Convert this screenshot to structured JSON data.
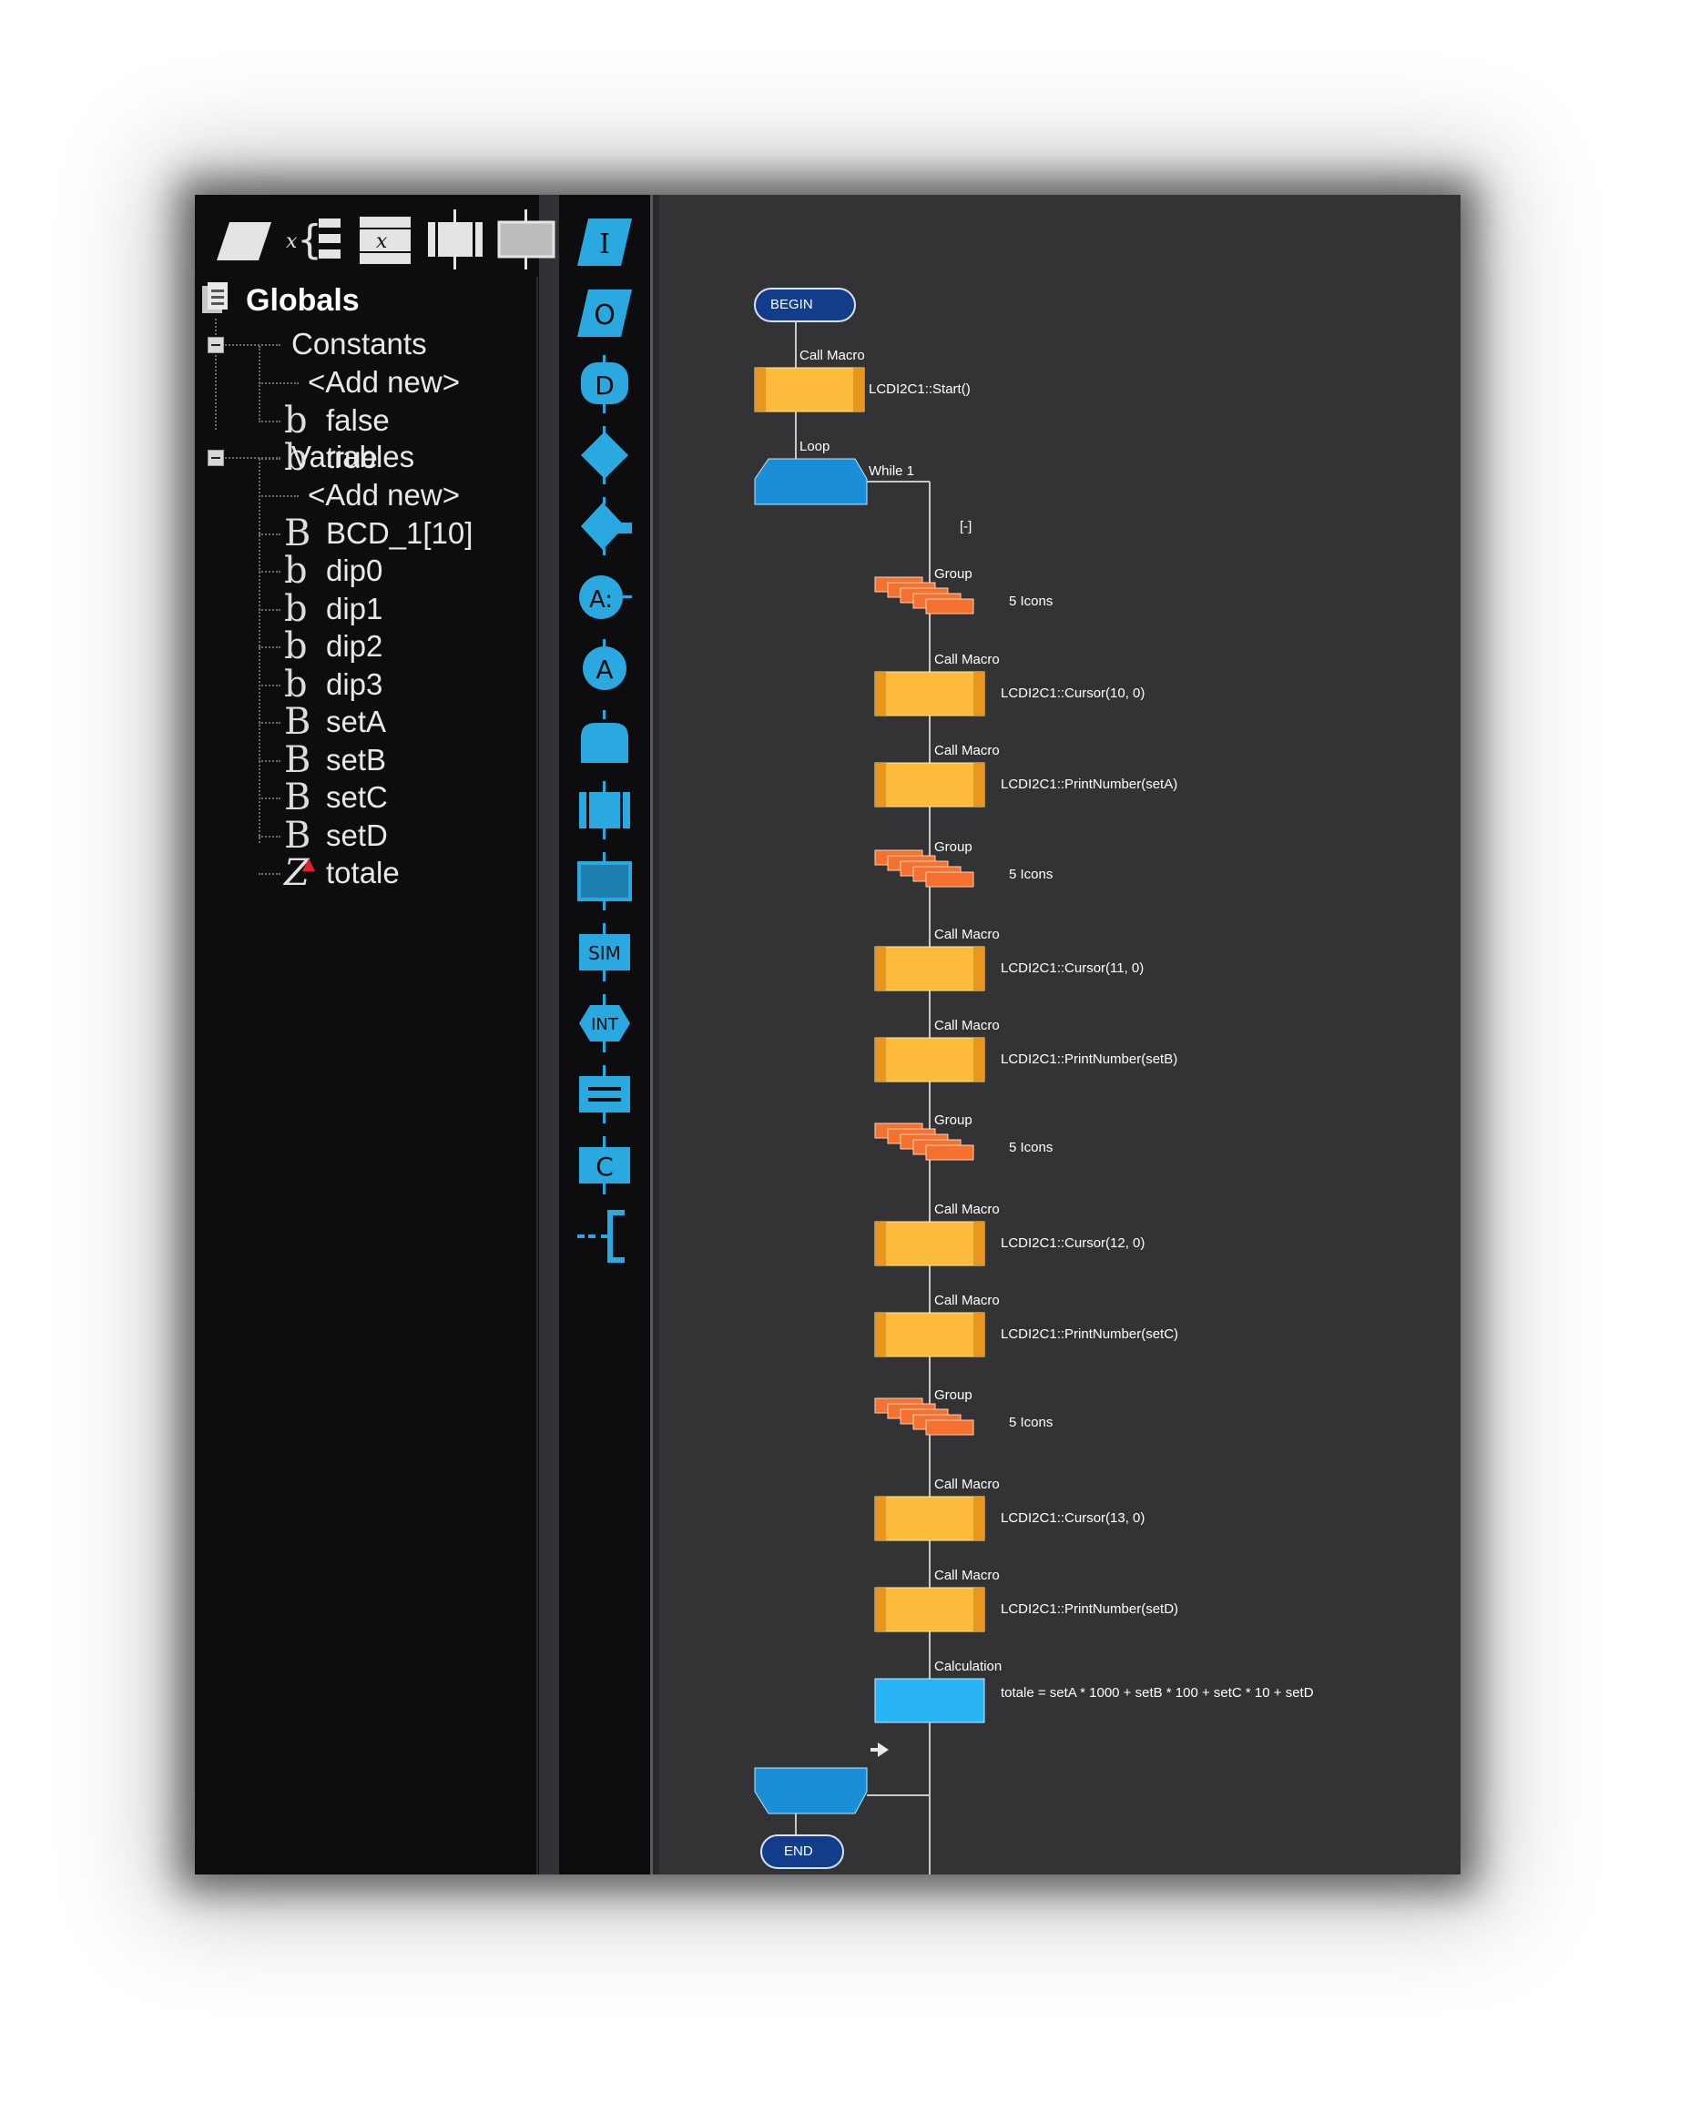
{
  "tree": {
    "root": "Globals",
    "constants_label": "Constants",
    "constants": [
      {
        "glyph": "",
        "name": "<Add new>"
      },
      {
        "glyph": "b",
        "name": "false"
      },
      {
        "glyph": "b",
        "name": "true"
      }
    ],
    "variables_label": "Variables",
    "variables": [
      {
        "glyph": "",
        "name": "<Add new>"
      },
      {
        "glyph": "B",
        "name": "BCD_1[10]"
      },
      {
        "glyph": "b",
        "name": "dip0"
      },
      {
        "glyph": "b",
        "name": "dip1"
      },
      {
        "glyph": "b",
        "name": "dip2"
      },
      {
        "glyph": "b",
        "name": "dip3"
      },
      {
        "glyph": "B",
        "name": "setA"
      },
      {
        "glyph": "B",
        "name": "setB"
      },
      {
        "glyph": "B",
        "name": "setC"
      },
      {
        "glyph": "B",
        "name": "setD"
      },
      {
        "glyph": "Z",
        "name": "totale"
      }
    ]
  },
  "strip_icons": {
    "input": "I",
    "output": "O",
    "delay": "D",
    "connection_point": "A:",
    "goto": "A",
    "simulation": "SIM",
    "interrupt": "INT",
    "component": "C"
  },
  "flowchart": {
    "begin": "BEGIN",
    "end": "END",
    "collapse_marker": "[-]",
    "steps": [
      {
        "kind": "macro",
        "label": "Call Macro",
        "desc": "LCDI2C1::Start()"
      },
      {
        "kind": "loop",
        "label": "Loop",
        "desc": "While 1"
      },
      {
        "kind": "group",
        "label": "Group",
        "desc": "5 Icons"
      },
      {
        "kind": "macro",
        "label": "Call Macro",
        "desc": "LCDI2C1::Cursor(10, 0)"
      },
      {
        "kind": "macro",
        "label": "Call Macro",
        "desc": "LCDI2C1::PrintNumber(setA)"
      },
      {
        "kind": "group",
        "label": "Group",
        "desc": "5 Icons"
      },
      {
        "kind": "macro",
        "label": "Call Macro",
        "desc": "LCDI2C1::Cursor(11, 0)"
      },
      {
        "kind": "macro",
        "label": "Call Macro",
        "desc": "LCDI2C1::PrintNumber(setB)"
      },
      {
        "kind": "group",
        "label": "Group",
        "desc": "5 Icons"
      },
      {
        "kind": "macro",
        "label": "Call Macro",
        "desc": "LCDI2C1::Cursor(12, 0)"
      },
      {
        "kind": "macro",
        "label": "Call Macro",
        "desc": "LCDI2C1::PrintNumber(setC)"
      },
      {
        "kind": "group",
        "label": "Group",
        "desc": "5 Icons"
      },
      {
        "kind": "macro",
        "label": "Call Macro",
        "desc": "LCDI2C1::Cursor(13, 0)"
      },
      {
        "kind": "macro",
        "label": "Call Macro",
        "desc": "LCDI2C1::PrintNumber(setD)"
      },
      {
        "kind": "calc",
        "label": "Calculation",
        "desc": "totale = setA * 1000 + setB * 100 + setC * 10 + setD"
      }
    ]
  },
  "colors": {
    "macro_fill": "#fdbb3c",
    "macro_stripe": "#e8961e",
    "group_fill": "#f4712f",
    "calc_fill": "#28b4f5",
    "loop_fill": "#1a8fd8",
    "terminal_fill": "#123d8a",
    "strip_icon": "#2aa8e0"
  }
}
